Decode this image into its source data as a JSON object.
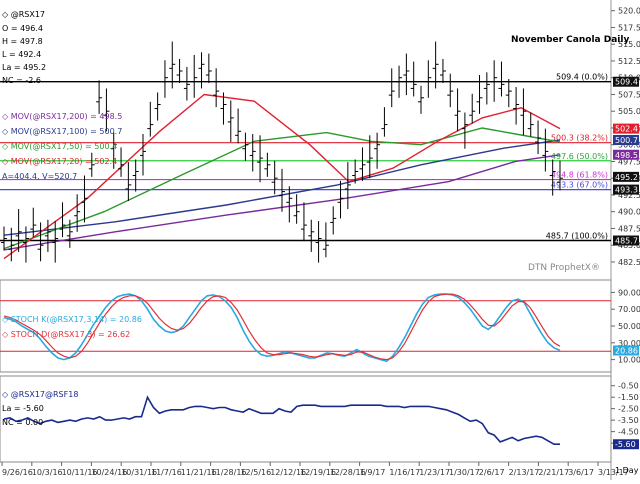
{
  "chart_data": [
    {
      "type": "ohlc",
      "title": "November Canola Daily",
      "symbol": "@RSX17",
      "readout": {
        "O": "496.4",
        "H": "497.8",
        "L": "492.4",
        "La": "495.2",
        "NC": "-2.6"
      },
      "indicators": [
        {
          "name": "MOV(@RSX17,200)",
          "value": "498.5",
          "color": "#7a2a9c"
        },
        {
          "name": "MOV(@RSX17,100)",
          "value": "500.7",
          "color": "#2a3a8c"
        },
        {
          "name": "MOV(@RSX17,50)",
          "value": "500.4",
          "color": "#2a9a2a"
        },
        {
          "name": "MOV(@RSX17,20)",
          "value": "502.4",
          "color": "#e0202e"
        }
      ],
      "fib_note": "A=404.4, V=520.7",
      "retracements": [
        {
          "label": "509.4 (0.0%)",
          "value": 509.4,
          "color": "#000000"
        },
        {
          "label": "500.3 (38.2%)",
          "value": 500.3,
          "color": "#e0202e"
        },
        {
          "label": "497.6 (50.0%)",
          "value": 497.6,
          "color": "#2ecc40"
        },
        {
          "label": "494.8 (61.8%)",
          "value": 494.8,
          "color": "#cc33cc"
        },
        {
          "label": "493.3 (67.0%)",
          "value": 493.3,
          "color": "#4b4bd6"
        },
        {
          "label": "485.7 (100.0%)",
          "value": 485.7,
          "color": "#000000"
        }
      ],
      "y_ticks": [
        "520.0",
        "517.5",
        "515.0",
        "512.5",
        "510.0",
        "507.5",
        "505.0",
        "502.5",
        "500.0",
        "497.5",
        "495.0",
        "492.5",
        "490.0",
        "487.5",
        "485.0",
        "482.5"
      ],
      "ylim": [
        481,
        521
      ],
      "price_badges": [
        {
          "text": "509.4",
          "value": 509.4,
          "bg": "#111111",
          "fg": "#ffffff"
        },
        {
          "text": "502.4",
          "value": 502.4,
          "bg": "#e0202e",
          "fg": "#ffffff"
        },
        {
          "text": "500.7",
          "value": 500.7,
          "bg": "#2a3a8c",
          "fg": "#ffffff"
        },
        {
          "text": "498.5",
          "value": 498.5,
          "bg": "#7a2a9c",
          "fg": "#ffffff"
        },
        {
          "text": "495.2",
          "value": 495.2,
          "bg": "#111111",
          "fg": "#ffffff"
        },
        {
          "text": "493.3",
          "value": 493.3,
          "bg": "#111111",
          "fg": "#ffffff"
        },
        {
          "text": "485.7",
          "value": 485.7,
          "bg": "#111111",
          "fg": "#ffffff"
        }
      ],
      "watermark": "DTN ProphetX®"
    },
    {
      "type": "line",
      "title": "",
      "series": [
        {
          "name": "STOCH K(@RSX17,3,14)",
          "value": "20.86",
          "color": "#29a9e0",
          "values": [
            60,
            58,
            55,
            50,
            46,
            42,
            35,
            26,
            18,
            12,
            10,
            12,
            18,
            28,
            40,
            52,
            62,
            72,
            80,
            85,
            87,
            88,
            86,
            80,
            70,
            58,
            50,
            44,
            42,
            44,
            50,
            60,
            70,
            80,
            86,
            87,
            85,
            80,
            72,
            60,
            45,
            32,
            22,
            16,
            14,
            15,
            17,
            19,
            18,
            16,
            14,
            12,
            12,
            15,
            18,
            17,
            15,
            14,
            18,
            22,
            18,
            14,
            12,
            10,
            8,
            14,
            24,
            36,
            50,
            64,
            76,
            84,
            87,
            88,
            88,
            87,
            84,
            78,
            70,
            60,
            50,
            46,
            52,
            62,
            72,
            80,
            82,
            78,
            65,
            52,
            40,
            30,
            24,
            21
          ]
        },
        {
          "name": "STOCH D(@RSX17,3)",
          "value": "26.62",
          "color": "#e0303a",
          "values": [
            62,
            60,
            57,
            53,
            49,
            45,
            40,
            33,
            25,
            18,
            14,
            12,
            14,
            20,
            30,
            42,
            54,
            64,
            73,
            80,
            84,
            86,
            86,
            83,
            77,
            68,
            59,
            52,
            47,
            45,
            47,
            53,
            62,
            72,
            80,
            85,
            86,
            84,
            78,
            69,
            57,
            44,
            33,
            24,
            18,
            16,
            16,
            17,
            18,
            17,
            16,
            14,
            13,
            14,
            16,
            17,
            16,
            15,
            16,
            19,
            19,
            16,
            13,
            11,
            10,
            12,
            19,
            29,
            42,
            56,
            69,
            79,
            85,
            87,
            88,
            88,
            86,
            82,
            75,
            67,
            58,
            51,
            50,
            56,
            65,
            74,
            79,
            79,
            72,
            61,
            49,
            38,
            30,
            26
          ]
        }
      ],
      "ylim": [
        0,
        100
      ],
      "y_ticks": [
        "90.00",
        "70.00",
        "50.00",
        "30.00",
        "10.00"
      ],
      "levels": [
        80,
        20
      ],
      "badges": [
        {
          "text": "20.86",
          "bg": "#29a9e0",
          "fg": "#ffffff"
        }
      ]
    },
    {
      "type": "line",
      "title": "",
      "series": [
        {
          "name": "@RSX17@RSF18",
          "color": "#1a2a8c",
          "values": [
            -3.4,
            -3.3,
            -3.6,
            -3.5,
            -3.3,
            -3.6,
            -3.8,
            -3.6,
            -3.5,
            -3.7,
            -3.6,
            -3.5,
            -3.6,
            -3.4,
            -3.3,
            -3.4,
            -3.2,
            -3.5,
            -3.5,
            -3.4,
            -3.3,
            -3.4,
            -3.2,
            -3.2,
            -1.5,
            -2.4,
            -2.9,
            -2.7,
            -2.6,
            -2.6,
            -2.6,
            -2.4,
            -2.3,
            -2.3,
            -2.4,
            -2.5,
            -2.4,
            -2.4,
            -2.6,
            -2.7,
            -2.8,
            -2.5,
            -2.7,
            -2.9,
            -2.9,
            -2.9,
            -2.5,
            -2.7,
            -2.8,
            -2.3,
            -2.2,
            -2.2,
            -2.2,
            -2.3,
            -2.3,
            -2.3,
            -2.3,
            -2.3,
            -2.2,
            -2.2,
            -2.2,
            -2.2,
            -2.2,
            -2.2,
            -2.3,
            -2.3,
            -2.3,
            -2.4,
            -2.3,
            -2.3,
            -2.3,
            -2.3,
            -2.4,
            -2.5,
            -2.6,
            -2.8,
            -3.0,
            -3.3,
            -3.6,
            -3.5,
            -3.8,
            -4.6,
            -4.8,
            -5.4,
            -5.2,
            -5.0,
            -5.3,
            -5.1,
            -5.0,
            -4.9,
            -5.0,
            -5.3,
            -5.6,
            -5.6
          ]
        }
      ],
      "readout": {
        "La": "-5.60",
        "NC": "0.00"
      },
      "ylim": [
        -6.8,
        0
      ],
      "y_ticks": [
        "-0.50",
        "-1.50",
        "-2.50",
        "-3.50",
        "-4.50",
        "-5.50"
      ],
      "badges": [
        {
          "text": "-5.60",
          "bg": "#1a2a8c",
          "fg": "#ffffff"
        }
      ]
    }
  ],
  "x_labels": [
    "9/26/16",
    "10/3/16",
    "10/11/16",
    "10/24/16",
    "10/31/16",
    "11/7/16",
    "11/21/16",
    "11/28/16",
    "12/5/16",
    "12/12/16",
    "12/19/16",
    "12/28/16",
    "1/9/17",
    "1/16/17",
    "1/23/17",
    "1/30/17",
    "2/6/17",
    "2/13/17",
    "2/21/17",
    "3/6/17",
    "3/13/17"
  ],
  "period_label": "1 Day"
}
